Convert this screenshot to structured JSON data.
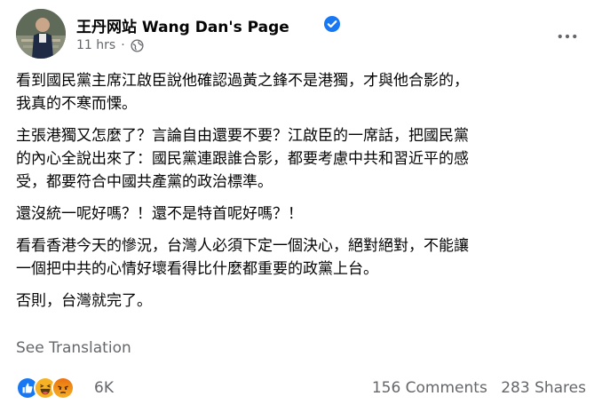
{
  "post": {
    "author": "王丹网站 Wang Dan's Page",
    "time": "11 hrs",
    "time_sep": "·",
    "paragraphs": [
      {
        "line1": "看到國民黨主席江啟臣說他確認過黃之鋒不是港獨，才與他合影的，",
        "line2": "我真的不寒而慄。"
      },
      {
        "line1": "主張港獨又怎麼了？言論自由還要不要？江啟臣的一席話，把國民黨",
        "line2": "的內心全說出來了：國民黨連跟誰合影，都要考慮中共和習近平的感",
        "line3": "受，都要符合中國共產黨的政治標準。"
      },
      {
        "line1": "還沒統一呢好嗎？！還不是特首呢好嗎？！"
      },
      {
        "line1": "看看香港今天的慘況，台灣人必須下定一個決心，絕對絕對，不能讓",
        "line2": "一個把中共的心情好壞看得比什麼都重要的政黨上台。"
      },
      {
        "line1": "否則，台灣就完了。"
      }
    ],
    "see_translation": "See Translation"
  },
  "engagement": {
    "reaction_count": "6K",
    "comments": "156 Comments",
    "shares": "283 Shares"
  },
  "icons": {
    "verified": "verified-badge-icon",
    "globe": "globe-icon",
    "more": "more-options-icon"
  },
  "colors": {
    "verified_blue": "#1877f2",
    "secondary_text": "#65676b",
    "like_blue": "#1877f2",
    "haha_yellow": "#f7b125",
    "angry_orange": "#e9710f"
  }
}
